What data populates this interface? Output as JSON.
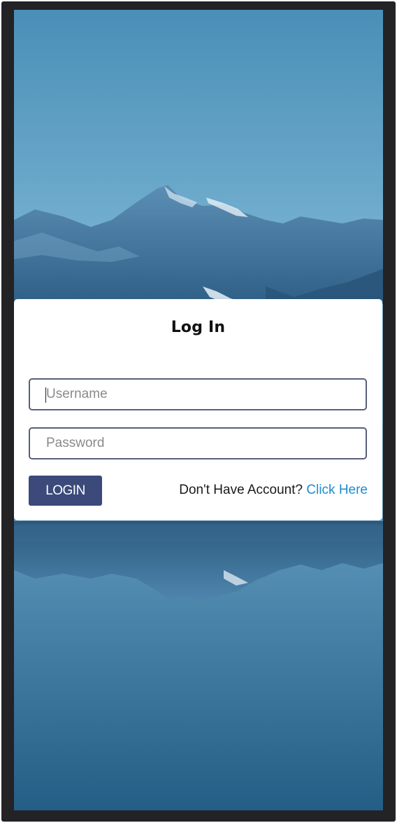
{
  "login_card": {
    "title": "Log In",
    "username": {
      "placeholder": "Username",
      "value": ""
    },
    "password": {
      "placeholder": "Password",
      "value": ""
    },
    "login_button_label": "LOGIN",
    "signup_prompt": "Don't Have Account?",
    "signup_link_label": "Click Here"
  },
  "colors": {
    "button_bg": "#3b4a7a",
    "link": "#1f8bd0",
    "field_border": "#58607a",
    "frame": "#232225"
  },
  "background_image": "mountain-lake-reflection"
}
